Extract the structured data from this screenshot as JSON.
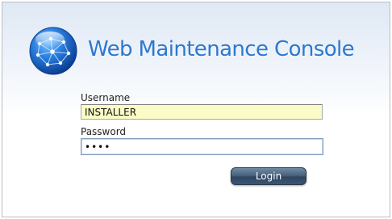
{
  "header": {
    "title": "Web Maintenance Console",
    "logo_icon": "globe-network-icon"
  },
  "form": {
    "username_label": "Username",
    "username_value": "INSTALLER",
    "password_label": "Password",
    "password_value": "••••",
    "login_label": "Login"
  },
  "colors": {
    "title": "#2c78cf",
    "username_field_bg": "#fafbc6",
    "button_bg": "#3a5574"
  }
}
